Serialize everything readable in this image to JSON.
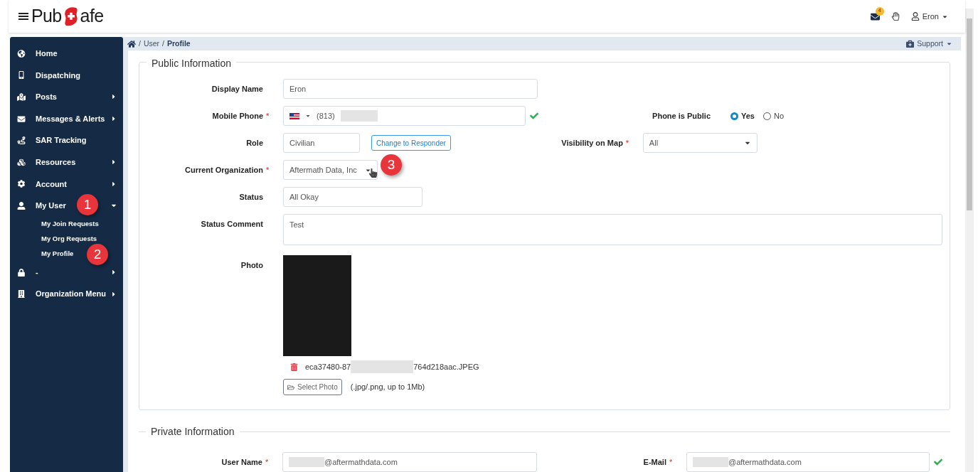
{
  "header": {
    "logo": {
      "left": "Pub",
      "right": "afe"
    },
    "mail_count": "4",
    "user": "Eron"
  },
  "breadcrumb": {
    "separator": "/",
    "items": [
      "User",
      "Profile"
    ],
    "support": "Support"
  },
  "sidebar": {
    "items": [
      {
        "kind": "globe",
        "label": "Home",
        "submenu": false
      },
      {
        "kind": "phone",
        "label": "Dispatching",
        "submenu": false
      },
      {
        "kind": "map",
        "label": "Posts",
        "submenu": true
      },
      {
        "kind": "mail",
        "label": "Messages & Alerts",
        "submenu": true
      },
      {
        "kind": "tracking",
        "label": "SAR Tracking",
        "submenu": false
      },
      {
        "kind": "resources",
        "label": "Resources",
        "submenu": true
      },
      {
        "kind": "gear",
        "label": "Account",
        "submenu": true
      },
      {
        "kind": "user",
        "label": "My User",
        "submenu": true,
        "expanded": true,
        "callout": "1",
        "children": [
          {
            "label": "My Join Requests"
          },
          {
            "label": "My Org Requests"
          },
          {
            "label": "My Profile",
            "callout": "2"
          }
        ]
      },
      {
        "kind": "lock",
        "label": "-",
        "submenu": true
      },
      {
        "kind": "building",
        "label": "Organization Menu",
        "submenu": true
      }
    ]
  },
  "public_info": {
    "title": "Public Information",
    "rows": [
      {
        "kind": "wide_text",
        "label": "Display Name",
        "value": "Eron"
      },
      {
        "kind": "phone",
        "label": "Mobile Phone",
        "required_mark": "*",
        "value": "(813)",
        "valid": true,
        "right": {
          "kind": "radio",
          "label": "Phone is Public",
          "options": [
            {
              "label": "Yes",
              "selected": true
            },
            {
              "label": "No",
              "selected": false
            }
          ]
        }
      },
      {
        "kind": "role",
        "label": "Role",
        "value": "Civilian",
        "button": "Change to Responder",
        "right": {
          "kind": "select",
          "label": "Visibility on Map",
          "required_mark": "*",
          "value": "All"
        }
      },
      {
        "kind": "org",
        "label": "Current Organization",
        "required_mark": "*",
        "value": "Aftermath Data, Inc",
        "callout": "3"
      },
      {
        "kind": "text",
        "label": "Status",
        "value": "All Okay"
      },
      {
        "kind": "textarea",
        "label": "Status Comment",
        "value": "Test"
      },
      {
        "kind": "photo",
        "label": "Photo",
        "file_start": "eca37480-87",
        "file_end": "764d218aac.JPEG",
        "button": "Select Photo",
        "hint": "(.jpg/.png, up to 1Mb)"
      }
    ]
  },
  "private_info": {
    "title": "Private Information",
    "rows": [
      {
        "label": "User Name",
        "required_mark": "*",
        "value": "@aftermathdata.com",
        "valid": false
      },
      {
        "label": "E-Mail",
        "required_mark": "*",
        "value": "@aftermathdata.com",
        "valid": true
      }
    ]
  }
}
